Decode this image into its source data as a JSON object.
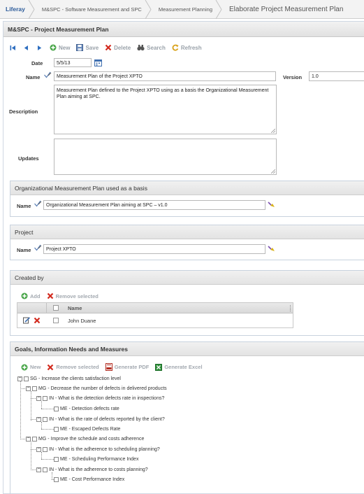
{
  "breadcrumb": [
    "Liferay",
    "M&SPC - Software Measurement and SPC",
    "Measurement Planning",
    "Elaborate Project Measurement Plan"
  ],
  "panel": {
    "title": "M&SPC - Project Measurement Plan"
  },
  "toolbar": {
    "new": "New",
    "save": "Save",
    "delete": "Delete",
    "search": "Search",
    "refresh": "Refresh"
  },
  "form": {
    "date_label": "Date",
    "date_value": "5/5/13",
    "name_label": "Name",
    "name_value": "Measurement Plan of the Project XPTO",
    "version_label": "Version",
    "version_value": "1.0",
    "description_label": "Description",
    "description_value": "Measurement Plan defined to the Project XPTO using as a basis the Organizational Measurement Plan aiming at SPC.",
    "updates_label": "Updates",
    "updates_value": ""
  },
  "org_plan": {
    "title": "Organizational Measurement Plan used as a basis",
    "name_label": "Name",
    "name_value": "Organizational Measurement Plan aiming at SPC – v1.0"
  },
  "project": {
    "title": "Project",
    "name_label": "Name",
    "name_value": "Project XPTO"
  },
  "created_by": {
    "title": "Created by",
    "add": "Add",
    "remove": "Remove selected",
    "column_name": "Name",
    "rows": [
      {
        "name": "John Duane"
      }
    ]
  },
  "goals": {
    "title": "Goals, Information Needs and Measures",
    "new": "New",
    "remove": "Remove selected",
    "pdf": "Generate PDF",
    "excel": "Generate Excel",
    "tree": [
      "SG - Increase the clients satisfaction level",
      "MG - Decrease the number of defects in delivered products",
      "IN - What is the detection defects rate in inspections?",
      "ME - Detection defects rate",
      "IN - What is the rate of defects reported by the client?",
      "ME - Escaped Defects Rate",
      "MG - Improve the schedule and costs adherence",
      "IN - What is the adherence to scheduling planning?",
      "ME - Scheduling Performance Index",
      "IN - What is the adherence to costs planning?",
      "ME - Cost Performance Index"
    ]
  },
  "colors": {
    "link": "#2c5b9a",
    "delete_red": "#d22a1e",
    "add_green": "#3a9a3a",
    "disabled_text": "#9aa2aa"
  }
}
